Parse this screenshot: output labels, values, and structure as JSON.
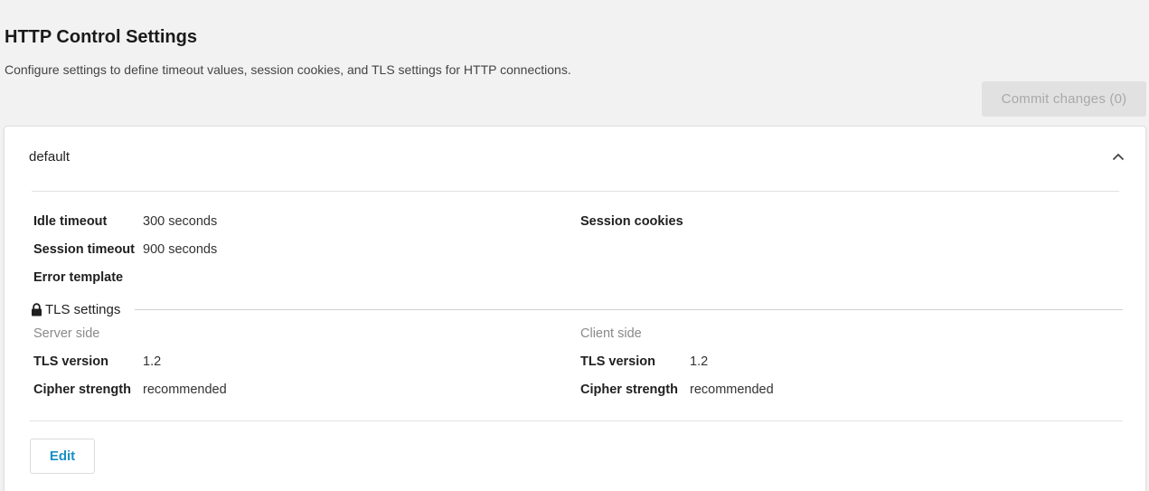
{
  "page": {
    "title": "HTTP Control Settings",
    "description": "Configure settings to define timeout values, session cookies, and TLS settings for HTTP connections."
  },
  "toolbar": {
    "commit_label": "Commit changes (0)"
  },
  "profile": {
    "name": "default",
    "collapse_icon": "chevron-up-icon",
    "settings": {
      "idle_timeout_label": "Idle timeout",
      "idle_timeout_value": "300 seconds",
      "session_timeout_label": "Session timeout",
      "session_timeout_value": "900 seconds",
      "error_template_label": "Error template",
      "session_cookies_label": "Session cookies"
    },
    "tls": {
      "heading": "TLS settings",
      "icon": "lock-icon",
      "server": {
        "heading": "Server side",
        "version_label": "TLS version",
        "version_value": "1.2",
        "cipher_label": "Cipher strength",
        "cipher_value": "recommended"
      },
      "client": {
        "heading": "Client side",
        "version_label": "TLS version",
        "version_value": "1.2",
        "cipher_label": "Cipher strength",
        "cipher_value": "recommended"
      }
    },
    "edit_label": "Edit"
  },
  "colors": {
    "accent": "#1b8fc6",
    "background": "#f2f2f2",
    "disabled_button": "#e1e1e1"
  }
}
